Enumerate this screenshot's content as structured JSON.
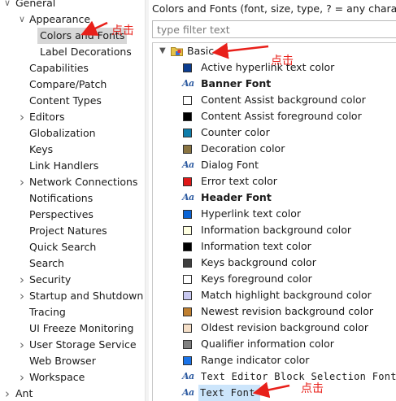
{
  "left_tree": [
    {
      "label": "General",
      "indent": 0,
      "twisty": "expanded"
    },
    {
      "label": "Appearance",
      "indent": 1,
      "twisty": "expanded"
    },
    {
      "label": "Colors and Fonts",
      "indent": 2,
      "twisty": "none",
      "selected": true
    },
    {
      "label": "Label Decorations",
      "indent": 2,
      "twisty": "none"
    },
    {
      "label": "Capabilities",
      "indent": 1,
      "twisty": "none"
    },
    {
      "label": "Compare/Patch",
      "indent": 1,
      "twisty": "none"
    },
    {
      "label": "Content Types",
      "indent": 1,
      "twisty": "none"
    },
    {
      "label": "Editors",
      "indent": 1,
      "twisty": "collapsed"
    },
    {
      "label": "Globalization",
      "indent": 1,
      "twisty": "none"
    },
    {
      "label": "Keys",
      "indent": 1,
      "twisty": "none"
    },
    {
      "label": "Link Handlers",
      "indent": 1,
      "twisty": "none"
    },
    {
      "label": "Network Connections",
      "indent": 1,
      "twisty": "collapsed"
    },
    {
      "label": "Notifications",
      "indent": 1,
      "twisty": "none"
    },
    {
      "label": "Perspectives",
      "indent": 1,
      "twisty": "none"
    },
    {
      "label": "Project Natures",
      "indent": 1,
      "twisty": "none"
    },
    {
      "label": "Quick Search",
      "indent": 1,
      "twisty": "none"
    },
    {
      "label": "Search",
      "indent": 1,
      "twisty": "none"
    },
    {
      "label": "Security",
      "indent": 1,
      "twisty": "collapsed"
    },
    {
      "label": "Startup and Shutdown",
      "indent": 1,
      "twisty": "collapsed"
    },
    {
      "label": "Tracing",
      "indent": 1,
      "twisty": "none"
    },
    {
      "label": "UI Freeze Monitoring",
      "indent": 1,
      "twisty": "none"
    },
    {
      "label": "User Storage Service",
      "indent": 1,
      "twisty": "collapsed"
    },
    {
      "label": "Web Browser",
      "indent": 1,
      "twisty": "none"
    },
    {
      "label": "Workspace",
      "indent": 1,
      "twisty": "collapsed"
    },
    {
      "label": "Ant",
      "indent": 0,
      "twisty": "collapsed"
    }
  ],
  "panel": {
    "description": "Colors and Fonts (font, size, type, ? = any character, * = any string):",
    "filter_placeholder": "type filter text",
    "filter_value": "",
    "category": "Basic",
    "items": [
      {
        "label": "Active hyperlink text color",
        "kind": "color",
        "color": "#0b3d91"
      },
      {
        "label": "Banner Font",
        "kind": "font",
        "style": "bold"
      },
      {
        "label": "Content Assist background color",
        "kind": "color",
        "color": "#ffffff"
      },
      {
        "label": "Content Assist foreground color",
        "kind": "color",
        "color": "#000000"
      },
      {
        "label": "Counter color",
        "kind": "color",
        "color": "#0f7eab"
      },
      {
        "label": "Decoration color",
        "kind": "color",
        "color": "#8a7442"
      },
      {
        "label": "Dialog Font",
        "kind": "font",
        "style": "normal"
      },
      {
        "label": "Error text color",
        "kind": "color",
        "color": "#e01818"
      },
      {
        "label": "Header Font",
        "kind": "font",
        "style": "bold"
      },
      {
        "label": "Hyperlink text color",
        "kind": "color",
        "color": "#0a64d6"
      },
      {
        "label": "Information background color",
        "kind": "color",
        "color": "#ffffe1"
      },
      {
        "label": "Information text color",
        "kind": "color",
        "color": "#000000"
      },
      {
        "label": "Keys background color",
        "kind": "color",
        "color": "#3f3f3f"
      },
      {
        "label": "Keys foreground color",
        "kind": "color",
        "color": "#ffffff"
      },
      {
        "label": "Match highlight background color",
        "kind": "color",
        "color": "#c8c8f0"
      },
      {
        "label": "Newest revision background color",
        "kind": "color",
        "color": "#c08030"
      },
      {
        "label": "Oldest revision background color",
        "kind": "color",
        "color": "#f5dfc8"
      },
      {
        "label": "Qualifier information color",
        "kind": "color",
        "color": "#808080"
      },
      {
        "label": "Range indicator color",
        "kind": "color",
        "color": "#1a73e8"
      },
      {
        "label": "Text Editor Block Selection Font",
        "kind": "font",
        "style": "mono"
      },
      {
        "label": "Text Font",
        "kind": "font",
        "style": "mono",
        "selected": true
      }
    ]
  },
  "annotations": {
    "label": "点击",
    "color": "#e8201a"
  }
}
